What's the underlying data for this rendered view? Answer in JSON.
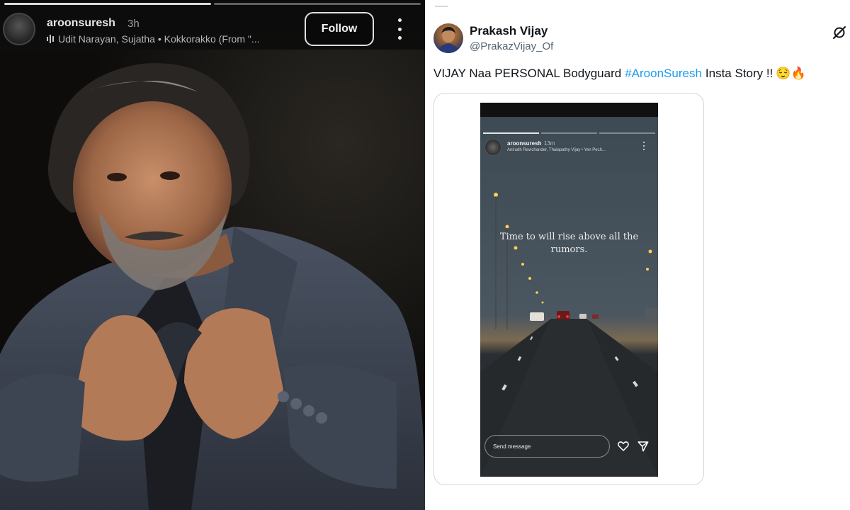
{
  "story_left": {
    "username": "aroonsuresh",
    "time": "3h",
    "music": "Udit Narayan, Sujatha • Kokkorakko (From \"...",
    "follow_label": "Follow",
    "progress": {
      "segments": 2,
      "completed": 1
    }
  },
  "tweet": {
    "author_name": "Prakash Vijay",
    "author_handle": "@PrakazVijay_Of",
    "text_before": "VIJAY Naa PERSONAL Bodyguard",
    "hashtag": "#AroonSuresh",
    "text_after": "Insta Story !!",
    "emojis": "😌🔥",
    "media": {
      "username": "aroonsuresh",
      "time": "13m",
      "music": "Anirudh Ravichander, Thalapathy Vijay • Yen Pech...",
      "caption": "Time to will rise above all the rumors.",
      "send_placeholder": "Send message",
      "progress": {
        "segments": 3,
        "completed": 1
      }
    }
  },
  "colors": {
    "link": "#1d9bf0",
    "text_primary": "#0f1419",
    "text_secondary": "#536471",
    "border": "#cfd9de"
  },
  "icons": {
    "more": "more-vertical-icon",
    "grok": "grok-icon",
    "music": "music-equalizer-icon",
    "like": "heart-icon",
    "send": "paper-plane-icon"
  }
}
